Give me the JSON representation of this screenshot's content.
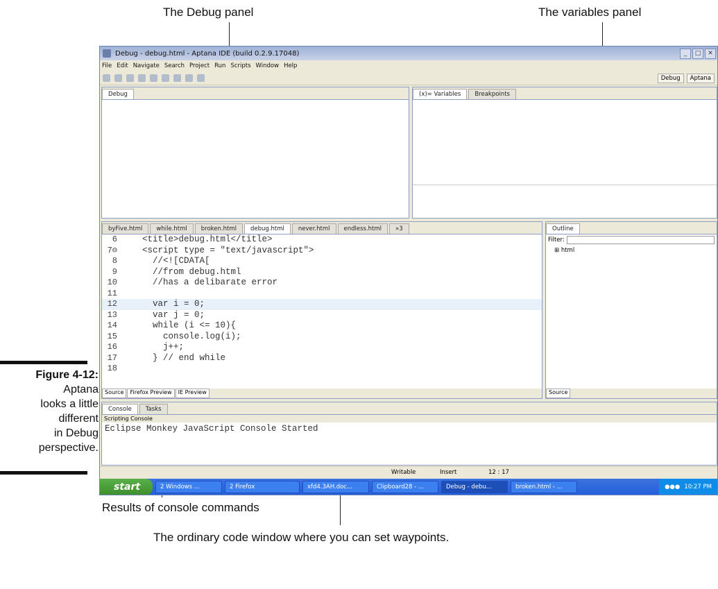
{
  "callouts": {
    "debug_panel": "The Debug panel",
    "variables_panel": "The variables panel",
    "results": "Results of console commands",
    "code_window": "The ordinary code window where you can set waypoints."
  },
  "figure": {
    "label": "Figure 4-12:",
    "caption_lines": [
      "Aptana",
      "looks a little",
      "different",
      "in Debug",
      "perspective."
    ]
  },
  "window": {
    "title": "Debug - debug.html - Aptana IDE (build 0.2.9.17048)",
    "menu": [
      "File",
      "Edit",
      "Navigate",
      "Search",
      "Project",
      "Run",
      "Scripts",
      "Window",
      "Help"
    ],
    "perspectives": [
      "Debug",
      "Aptana"
    ]
  },
  "debug_panel": {
    "tab": "Debug"
  },
  "variables_panel": {
    "tabs": [
      "(x)= Variables",
      "Breakpoints"
    ]
  },
  "editor": {
    "tabs": [
      "byFive.html",
      "while.html",
      "broken.html",
      "debug.html",
      "never.html",
      "endless.html",
      "»3"
    ],
    "lines": [
      {
        "n": "6",
        "text": "    <title>debug.html</title>"
      },
      {
        "n": "7⊖",
        "text": "    <script type = \"text/javascript\">"
      },
      {
        "n": "8",
        "text": "      //<![CDATA["
      },
      {
        "n": "9",
        "text": "      //from debug.html"
      },
      {
        "n": "10",
        "text": "      //has a delibarate error"
      },
      {
        "n": "11",
        "text": ""
      },
      {
        "n": "12",
        "text": "      var i = 0;"
      },
      {
        "n": "13",
        "text": "      var j = 0;"
      },
      {
        "n": "14",
        "text": "      while (i <= 10){"
      },
      {
        "n": "15",
        "text": "        console.log(i);"
      },
      {
        "n": "16",
        "text": "        j++;"
      },
      {
        "n": "17",
        "text": "      } // end while"
      },
      {
        "n": "18",
        "text": ""
      }
    ],
    "subtabs": [
      "Source",
      "Firefox Preview",
      "IE Preview"
    ]
  },
  "outline": {
    "tab": "Outline",
    "filter_label": "Filter:",
    "node": "html",
    "subtab": "Source"
  },
  "console": {
    "tabs": [
      "Console",
      "Tasks"
    ],
    "subtitle": "Scripting Console",
    "output": "Eclipse Monkey JavaScript Console Started"
  },
  "status": {
    "writable": "Writable",
    "insert": "Insert",
    "position": "12 : 17"
  },
  "taskbar": {
    "start": "start",
    "items": [
      "2 Windows ...",
      "2 Firefox",
      "xfd4.3AH.doc...",
      "Clipboard28 - ...",
      "Debug - debu...",
      "broken.html - ..."
    ],
    "clock": "10:27 PM"
  }
}
